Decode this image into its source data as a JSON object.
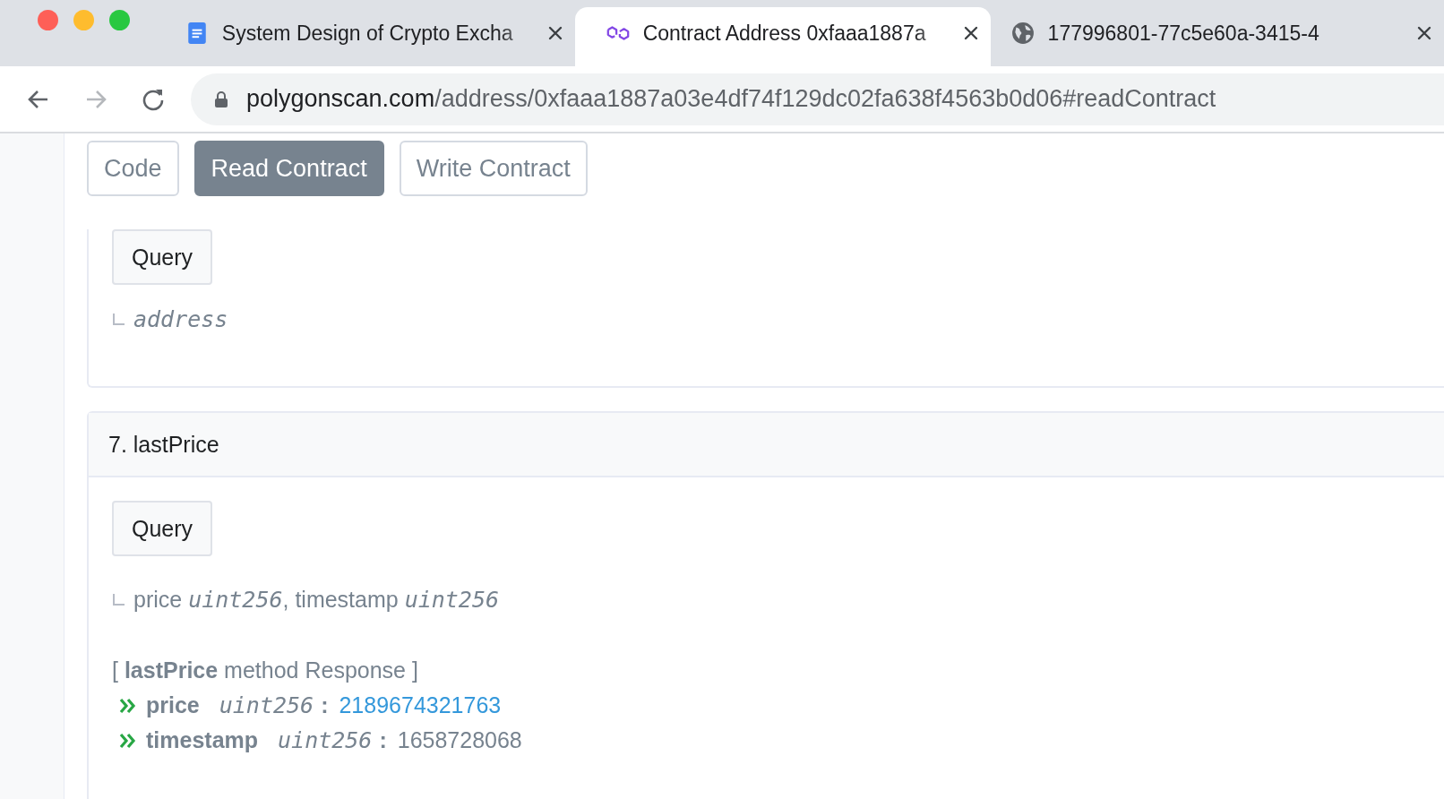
{
  "browser": {
    "tabs": [
      {
        "title": "System Design of Crypto Excha",
        "selected": false,
        "kind": "doc"
      },
      {
        "title": "Contract Address 0xfaaa1887a",
        "selected": true,
        "kind": "polygon"
      },
      {
        "title": "177996801-77c5e60a-3415-4",
        "selected": false,
        "kind": "globe"
      }
    ],
    "url": {
      "host": "polygonscan.com",
      "path": "/address/0xfaaa1887a03e4df74f129dc02fa638f4563b0d06#readContract"
    }
  },
  "contract_tabs": [
    {
      "label": "Code",
      "selected": false
    },
    {
      "label": "Read Contract",
      "selected": true
    },
    {
      "label": "Write Contract",
      "selected": false
    }
  ],
  "methods": [
    {
      "button": "Query",
      "outputs": [
        {
          "text": "address",
          "kind": "type"
        }
      ]
    },
    {
      "title": "7. lastPrice",
      "button": "Query",
      "outputs": [
        {
          "text": "price *uint256*, timestamp *uint256*",
          "kind": "mixed"
        }
      ],
      "response": {
        "heading": "[ **lastPrice** method Response ]",
        "items": [
          {
            "name": "price",
            "type": "uint256",
            "separator": ":",
            "value": "2189674321763",
            "kind": "link"
          },
          {
            "name": "timestamp",
            "type": "uint256",
            "separator": ":",
            "value": "1658728068",
            "kind": "text"
          }
        ]
      }
    }
  ]
}
